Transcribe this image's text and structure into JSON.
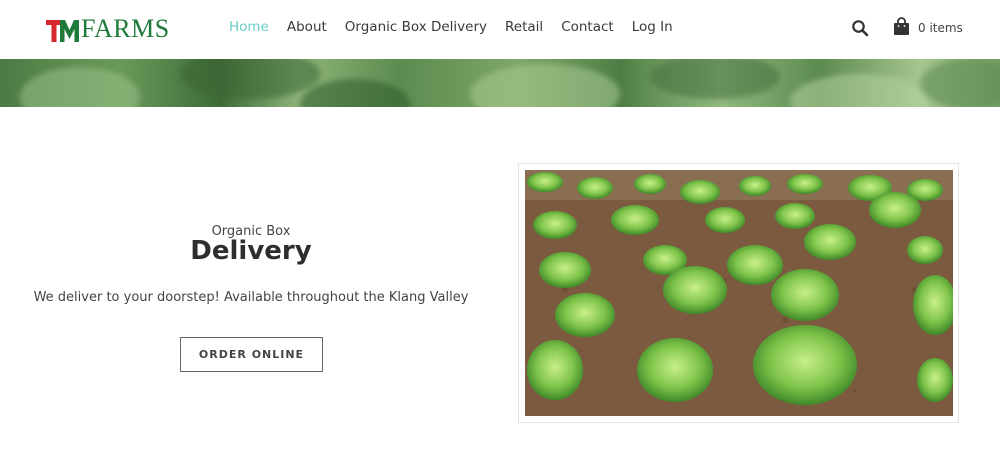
{
  "logo": {
    "mark": "TM",
    "wordmark": "FARMS"
  },
  "nav": {
    "items": [
      {
        "label": "Home",
        "active": true
      },
      {
        "label": "About",
        "active": false
      },
      {
        "label": "Organic Box Delivery",
        "active": false
      },
      {
        "label": "Retail",
        "active": false
      },
      {
        "label": "Contact",
        "active": false
      },
      {
        "label": "Log In",
        "active": false
      }
    ]
  },
  "header": {
    "search_icon": "search-icon",
    "cart_icon": "shopping-bag-icon",
    "cart_count": "0 items"
  },
  "hero": {
    "subtitle": "Organic Box",
    "title": "Delivery",
    "description": "We deliver to your doorstep! Available throughout the Klang Valley",
    "cta_label": "ORDER ONLINE"
  },
  "colors": {
    "accent": "#67cfc7",
    "logo_red": "#d6262e",
    "logo_green": "#1e7a3a",
    "text": "#333333"
  }
}
